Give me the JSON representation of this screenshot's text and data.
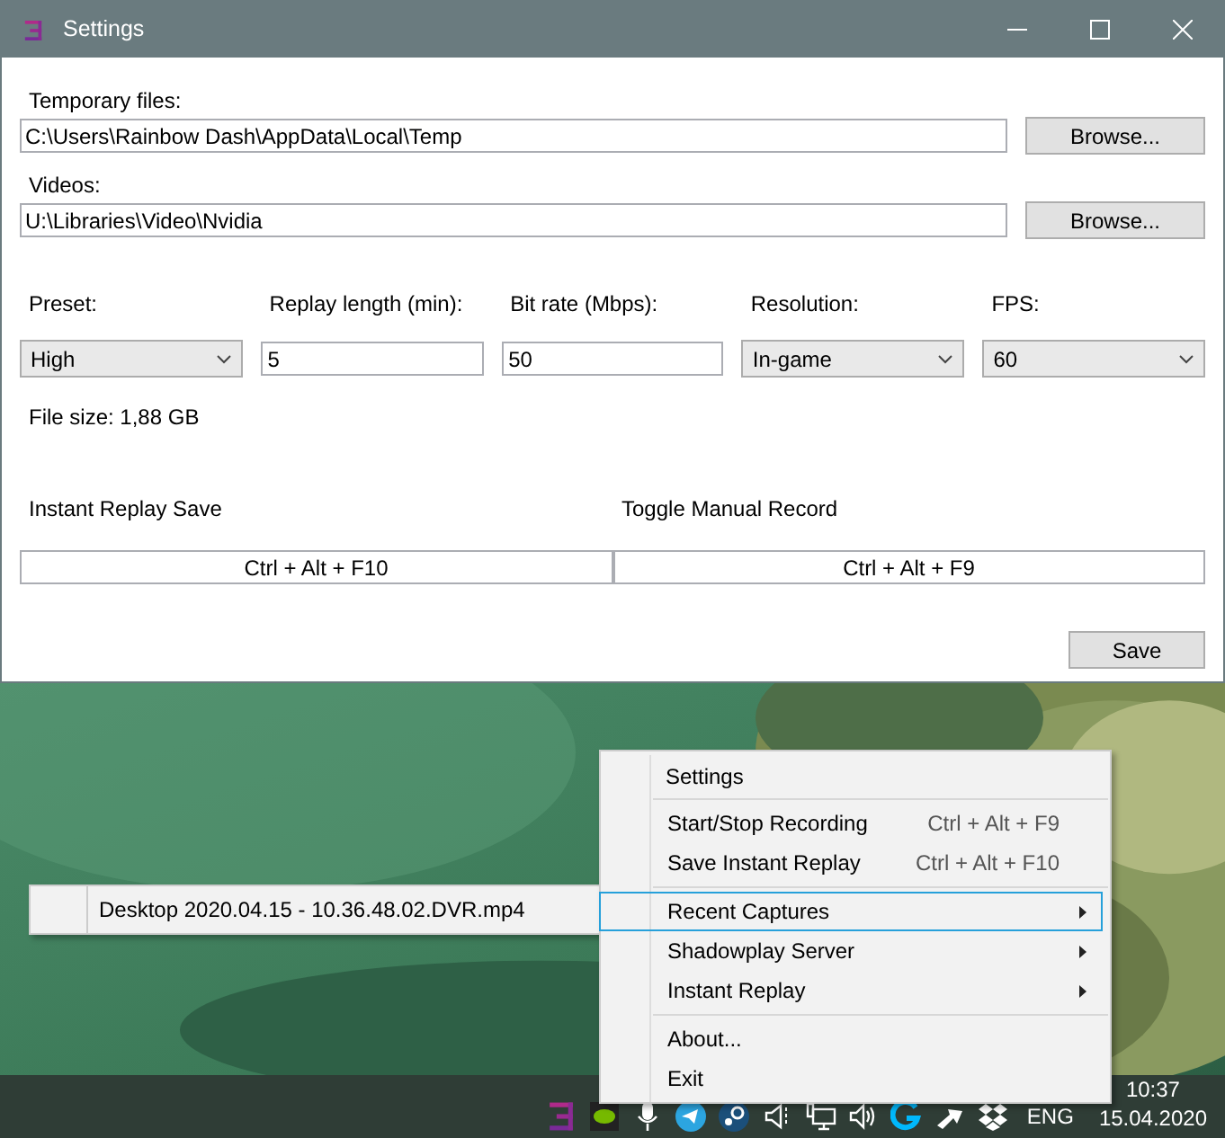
{
  "window": {
    "title": "Settings"
  },
  "paths": [
    {
      "label": "Temporary files:",
      "value": "C:\\Users\\Rainbow Dash\\AppData\\Local\\Temp",
      "button": "Browse..."
    },
    {
      "label": "Videos:",
      "value": "U:\\Libraries\\Video\\Nvidia",
      "button": "Browse..."
    }
  ],
  "options": [
    {
      "label": "Preset:",
      "value": "High",
      "kind": "select"
    },
    {
      "label": "Replay length (min):",
      "value": "5",
      "kind": "input"
    },
    {
      "label": "Bit rate (Mbps):",
      "value": "50",
      "kind": "input"
    },
    {
      "label": "Resolution:",
      "value": "In-game",
      "kind": "select"
    },
    {
      "label": "FPS:",
      "value": "60",
      "kind": "select"
    }
  ],
  "file_size": "File size: 1,88 GB",
  "hotkeys": [
    {
      "label": "Instant Replay Save",
      "value": "Ctrl + Alt + F10"
    },
    {
      "label": "Toggle Manual Record",
      "value": "Ctrl + Alt + F9"
    }
  ],
  "save_button": "Save",
  "context_menu": {
    "groups": [
      [
        {
          "label": "Settings",
          "selected": false,
          "submenu": false
        }
      ],
      [
        {
          "label": "Start/Stop Recording",
          "shortcut": "Ctrl + Alt + F9",
          "selected": false,
          "submenu": false
        },
        {
          "label": "Save Instant Replay",
          "shortcut": "Ctrl + Alt + F10",
          "selected": false,
          "submenu": false
        }
      ],
      [
        {
          "label": "Recent Captures",
          "selected": true,
          "submenu": true
        },
        {
          "label": "Shadowplay Server",
          "selected": false,
          "submenu": true
        },
        {
          "label": "Instant Replay",
          "selected": false,
          "submenu": true
        }
      ],
      [
        {
          "label": "About...",
          "selected": false,
          "submenu": false
        },
        {
          "label": "Exit",
          "selected": false,
          "submenu": false
        }
      ]
    ]
  },
  "submenu": {
    "items": [
      "Desktop 2020.04.15 - 10.36.48.02.DVR.mp4"
    ]
  },
  "taskbar": {
    "language": "ENG",
    "time": "10:37",
    "date": "15.04.2020"
  }
}
